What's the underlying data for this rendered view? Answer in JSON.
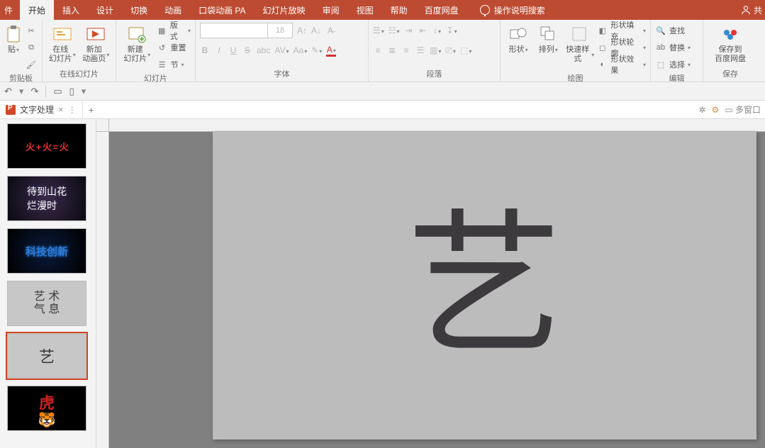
{
  "tabs": {
    "file": "件",
    "items": [
      "开始",
      "插入",
      "设计",
      "切换",
      "动画",
      "口袋动画 PA",
      "幻灯片放映",
      "审阅",
      "视图",
      "帮助",
      "百度网盘"
    ],
    "active_index": 0,
    "search_placeholder": "操作说明搜索",
    "share": "共"
  },
  "ribbon": {
    "clipboard": {
      "paste": "贴",
      "label": "剪贴板"
    },
    "online_slides": {
      "online": "在线\n幻灯片",
      "newanim": "新加\n动画页",
      "label": "在线幻灯片"
    },
    "slides": {
      "newslide": "新建\n幻灯片",
      "layout": "版式",
      "reset": "重置",
      "section": "节",
      "label": "幻灯片"
    },
    "font": {
      "size_placeholder": "18",
      "label": "字体",
      "bold": "B",
      "italic": "I",
      "underline": "U",
      "strike": "S",
      "shadow": "abc",
      "spacing": "AV",
      "case": "Aa"
    },
    "paragraph": {
      "label": "段落"
    },
    "drawing": {
      "shapes": "形状",
      "arrange": "排列",
      "quick": "快速样式",
      "fill": "形状填充",
      "outline": "形状轮廓",
      "effects": "形状效果",
      "label": "绘图"
    },
    "editing": {
      "find": "查找",
      "replace": "替换",
      "select": "选择",
      "label": "编辑"
    },
    "baidu": {
      "save": "保存到\n百度网盘",
      "label": "保存"
    }
  },
  "doc": {
    "title": "文字处理",
    "multiwindow": "多窗口"
  },
  "thumbs": [
    {
      "text": "火 + 火 = 火"
    },
    {
      "text": "待到山花\n烂漫时"
    },
    {
      "text": "科技创新"
    },
    {
      "text": "艺 术\n气 息"
    },
    {
      "text": "艺"
    },
    {
      "text": "虎"
    }
  ],
  "canvas": {
    "glyph": "艺"
  }
}
